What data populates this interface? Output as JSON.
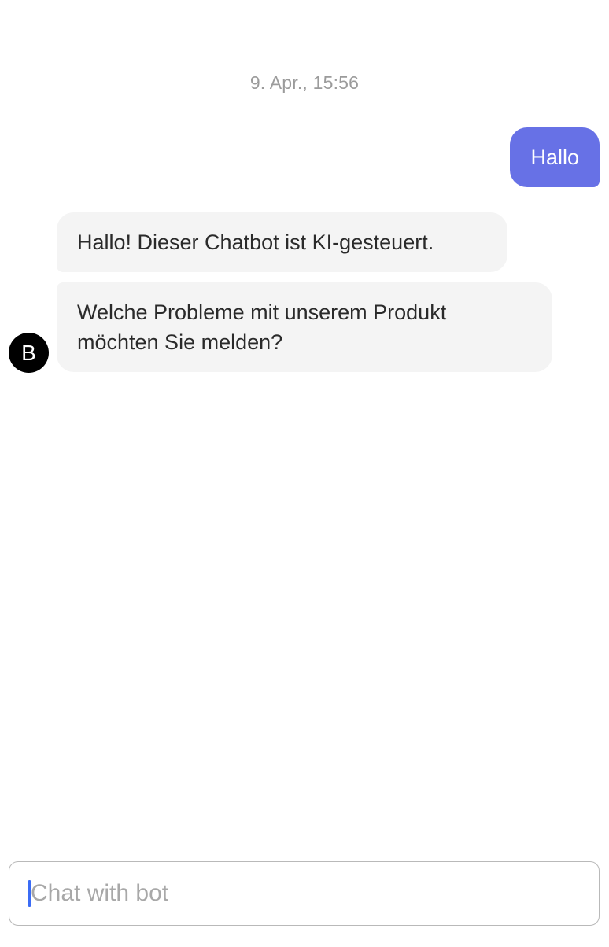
{
  "timestamp": "9. Apr., 15:56",
  "messages": {
    "user_1": "Hallo",
    "bot_1": "Hallo! Dieser Chatbot ist KI-gesteuert.",
    "bot_2": "Welche Probleme mit unserem Produkt möchten Sie melden?"
  },
  "bot": {
    "avatar_letter": "B"
  },
  "composer": {
    "placeholder": "Chat with bot",
    "value": ""
  },
  "colors": {
    "user_bubble": "#6771e6",
    "bot_bubble": "#f4f4f4",
    "caret": "#3b6cf5"
  }
}
